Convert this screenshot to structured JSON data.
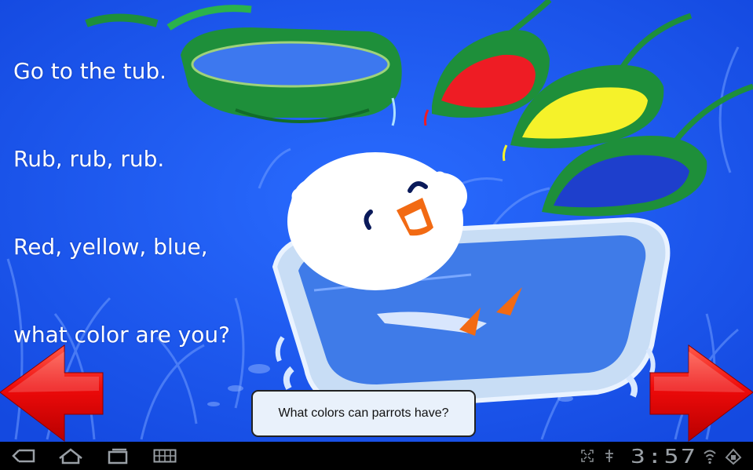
{
  "story": {
    "lines": [
      "Go to the tub.",
      "Rub, rub, rub.",
      "Red, yellow, blue,",
      "what color are you?"
    ]
  },
  "question": {
    "label": "What colors can parrots have?"
  },
  "status": {
    "time": "3:57"
  },
  "colors": {
    "background": "#1a5cf5",
    "arrow": "#e60000",
    "leaf": "#1e8f3a",
    "paint_red": "#ee1c24",
    "paint_yellow": "#f5f22a",
    "paint_blue": "#1e3fcc",
    "tub": "#c8ddf5"
  },
  "icons": {
    "nav": [
      "back-icon",
      "home-icon",
      "recent-apps-icon",
      "keyboard-icon"
    ],
    "status": [
      "fullscreen-icon",
      "usb-icon",
      "wifi-icon",
      "battery-icon"
    ]
  }
}
